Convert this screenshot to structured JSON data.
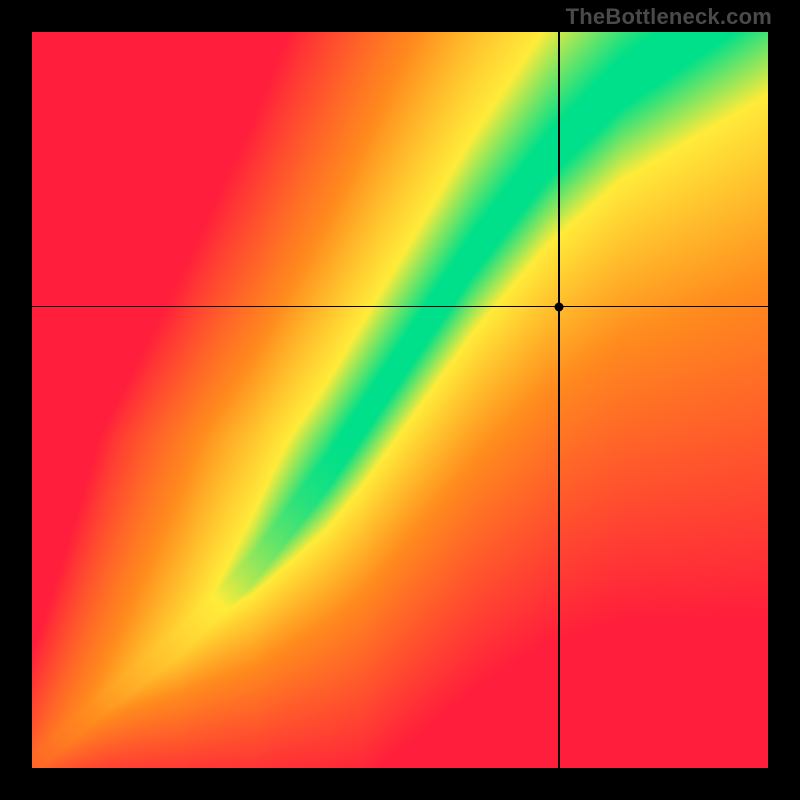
{
  "attribution": "TheBottleneck.com",
  "chart_data": {
    "type": "heatmap",
    "title": "",
    "xlabel": "",
    "ylabel": "",
    "xlim": [
      0,
      1
    ],
    "ylim": [
      0,
      1
    ],
    "resolution": 200,
    "green_path": [
      [
        0.02,
        0.02
      ],
      [
        0.1,
        0.09
      ],
      [
        0.2,
        0.17
      ],
      [
        0.3,
        0.27
      ],
      [
        0.4,
        0.4
      ],
      [
        0.5,
        0.55
      ],
      [
        0.6,
        0.7
      ],
      [
        0.7,
        0.83
      ],
      [
        0.8,
        0.93
      ],
      [
        0.9,
        1.0
      ]
    ],
    "green_width_frac": 0.06,
    "crosshair": {
      "x": 0.716,
      "y": 0.627
    },
    "marker": {
      "x": 0.716,
      "y": 0.627,
      "radius_px": 4.5
    },
    "colors": {
      "green": "#00e08a",
      "yellow": "#ffec3a",
      "orange": "#ff8c1e",
      "red": "#ff1e3c"
    }
  }
}
